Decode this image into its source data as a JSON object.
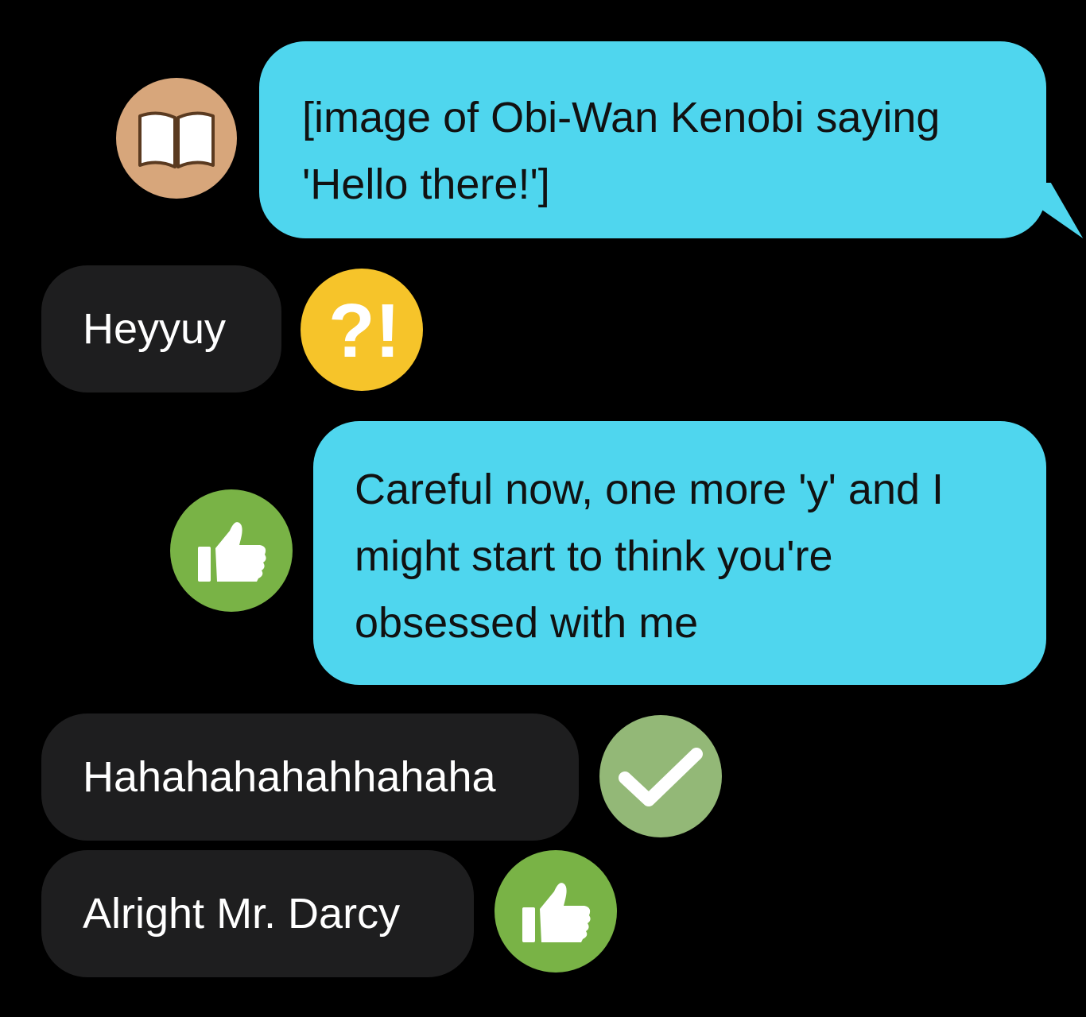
{
  "messages": [
    {
      "direction": "outgoing",
      "text": "[image of Obi-Wan Kenobi saying\n'Hello there!']",
      "reaction": {
        "icon": "book-icon",
        "color": "#d7a67b"
      }
    },
    {
      "direction": "incoming",
      "text": "Heyyuy",
      "reaction": {
        "icon": "interrobang-icon",
        "color": "#f6c42a"
      }
    },
    {
      "direction": "outgoing",
      "text": "Careful now, one more 'y' and I\nmight start to think you're\nobsessed with me",
      "reaction": {
        "icon": "thumbs-up-icon",
        "color": "#79b346"
      }
    },
    {
      "direction": "incoming",
      "text": "Hahahahahahhahaha",
      "reaction": {
        "icon": "checkmark-icon",
        "color": "#93b877"
      }
    },
    {
      "direction": "incoming",
      "text": "Alright Mr. Darcy",
      "reaction": {
        "icon": "thumbs-up-icon",
        "color": "#79b346"
      }
    }
  ],
  "colors": {
    "background": "#000000",
    "outgoing_bubble": "#4fd6ee",
    "incoming_bubble": "#1e1e1f",
    "outgoing_text": "#111111",
    "incoming_text": "#ffffff"
  }
}
